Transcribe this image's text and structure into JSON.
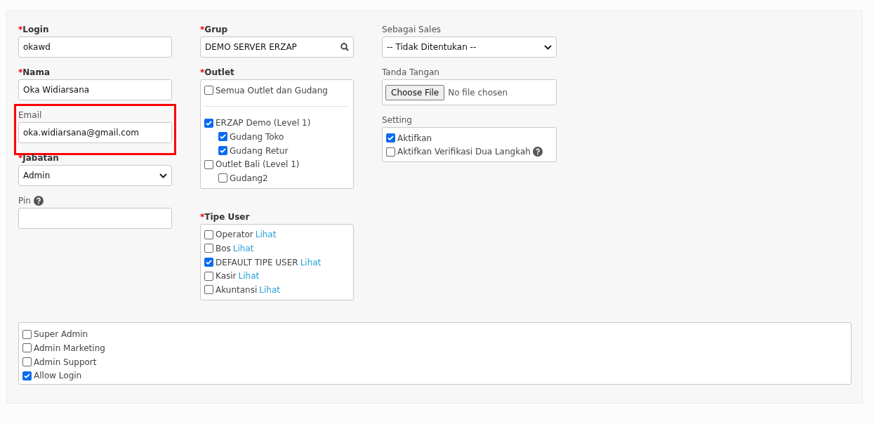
{
  "columns": [
    {
      "fields": [
        {
          "kind": "text",
          "label": "Login",
          "required_mark": "*",
          "value": "okawd",
          "highlighted": false
        },
        {
          "kind": "text",
          "label": "Nama",
          "required_mark": "*",
          "value": "Oka Widiarsana",
          "highlighted": false
        },
        {
          "kind": "text",
          "label": "Email",
          "value": "oka.widiarsana@gmail.com",
          "highlighted": true
        },
        {
          "kind": "select",
          "label": "Jabatan",
          "required_mark": "*",
          "value": "Admin",
          "highlighted": false
        },
        {
          "kind": "text",
          "label": "Pin",
          "help": true,
          "highlighted": false
        }
      ]
    },
    {
      "fields": [
        {
          "kind": "search",
          "label": "Grup",
          "required_mark": "*",
          "value": "DEMO SERVER ERZAP",
          "highlighted": false
        },
        {
          "kind": "tree",
          "label": "Outlet",
          "required_mark": "*",
          "all_option": {
            "label": "Semua Outlet dan Gudang",
            "checked": false
          },
          "items": [
            {
              "label": "ERZAP Demo (Level 1)",
              "checked": true,
              "children": [
                {
                  "label": "Gudang Toko",
                  "checked": true
                },
                {
                  "label": "Gudang Retur",
                  "checked": true
                }
              ]
            },
            {
              "label": "Outlet Bali (Level 1)",
              "checked": false,
              "children": [
                {
                  "label": "Gudang2",
                  "checked": false
                }
              ]
            }
          ],
          "highlighted": false
        },
        {
          "kind": "checklist",
          "label": "Tipe User",
          "required_mark": "*",
          "items": [
            {
              "label": "Operator",
              "link": "Lihat",
              "checked": false
            },
            {
              "label": "Bos",
              "link": "Lihat",
              "checked": false
            },
            {
              "label": "DEFAULT TIPE USER",
              "link": "Lihat",
              "checked": true
            },
            {
              "label": "Kasir",
              "link": "Lihat",
              "checked": false
            },
            {
              "label": "Akuntansi",
              "link": "Lihat",
              "checked": false
            }
          ],
          "highlighted": false
        }
      ]
    },
    {
      "fields": [
        {
          "kind": "select",
          "label": "Sebagai Sales",
          "value": "-- Tidak Ditentukan --",
          "highlighted": false
        },
        {
          "kind": "file",
          "label": "Tanda Tangan",
          "button": "Choose File",
          "status": "No file chosen",
          "highlighted": false
        },
        {
          "kind": "checklist",
          "label": "Setting",
          "items": [
            {
              "label": "Aktifkan",
              "checked": true,
              "help": false
            },
            {
              "label": "Aktifkan Verifikasi Dua Langkah",
              "checked": false,
              "help": true
            }
          ],
          "highlighted": false
        }
      ]
    }
  ],
  "roles": [
    {
      "label": "Super Admin",
      "checked": false
    },
    {
      "label": "Admin Marketing",
      "checked": false
    },
    {
      "label": "Admin Support",
      "checked": false
    },
    {
      "label": "Allow Login",
      "checked": true
    }
  ]
}
